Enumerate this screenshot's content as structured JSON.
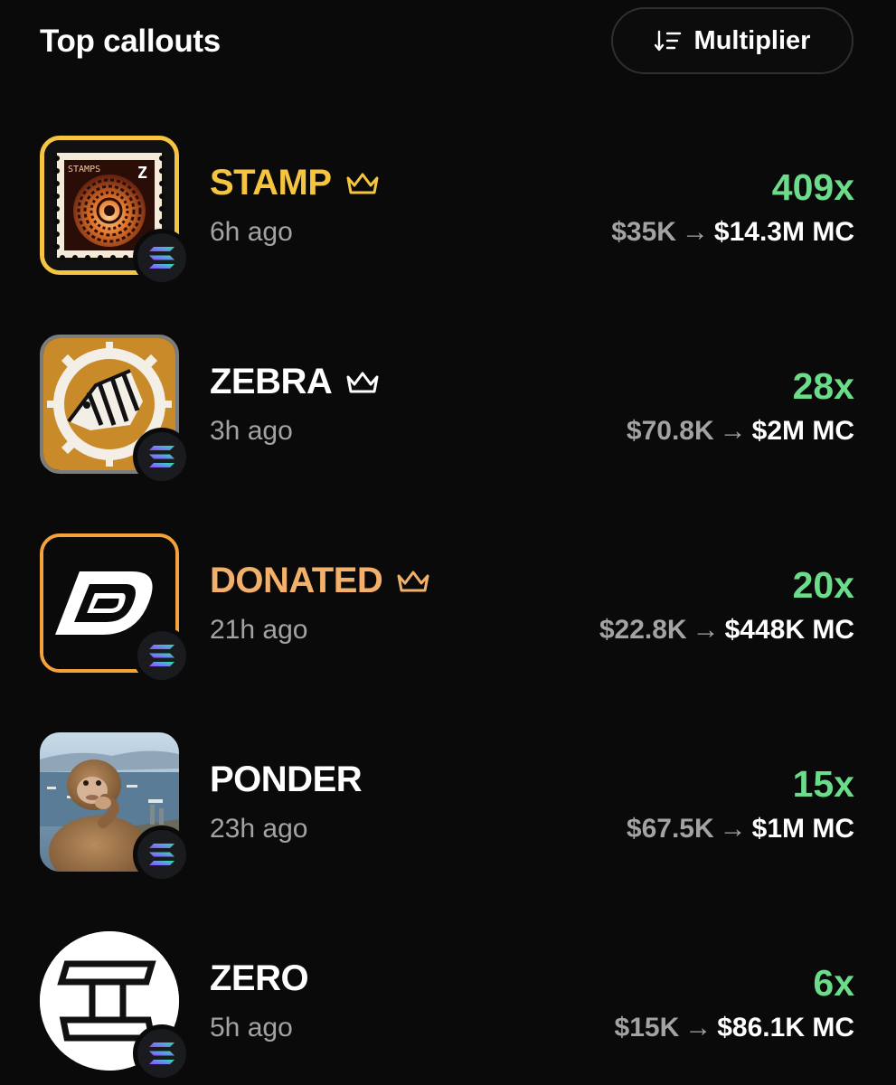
{
  "header": {
    "title": "Top callouts",
    "sort_label": "Multiplier",
    "sort_icon": "sort-descending-icon"
  },
  "colors": {
    "background": "#0a0a0a",
    "multiplier_green": "#6bdc8a",
    "secondary_text": "#a3a3a3",
    "stamp_gold": "#f5c542",
    "donated_orange": "#f3b06a"
  },
  "callouts": [
    {
      "name": "STAMP",
      "name_color": "#f5c542",
      "crown": true,
      "time": "6h ago",
      "multiplier": "409x",
      "from": "$35K",
      "arrow": "→",
      "to": "$14.3M",
      "unit": "MC",
      "chain": "solana-icon",
      "avatar_label": "STAMPS",
      "avatar_glyph": "Z"
    },
    {
      "name": "ZEBRA",
      "name_color": "#ffffff",
      "crown": true,
      "time": "3h ago",
      "multiplier": "28x",
      "from": "$70.8K",
      "arrow": "→",
      "to": "$2M",
      "unit": "MC",
      "chain": "solana-icon"
    },
    {
      "name": "DONATED",
      "name_color": "#f3b06a",
      "crown": true,
      "time": "21h ago",
      "multiplier": "20x",
      "from": "$22.8K",
      "arrow": "→",
      "to": "$448K",
      "unit": "MC",
      "chain": "solana-icon"
    },
    {
      "name": "PONDER",
      "name_color": "#ffffff",
      "crown": false,
      "time": "23h ago",
      "multiplier": "15x",
      "from": "$67.5K",
      "arrow": "→",
      "to": "$1M",
      "unit": "MC",
      "chain": "solana-icon"
    },
    {
      "name": "ZERO",
      "name_color": "#ffffff",
      "crown": false,
      "time": "5h ago",
      "multiplier": "6x",
      "from": "$15K",
      "arrow": "→",
      "to": "$86.1K",
      "unit": "MC",
      "chain": "solana-icon"
    }
  ]
}
